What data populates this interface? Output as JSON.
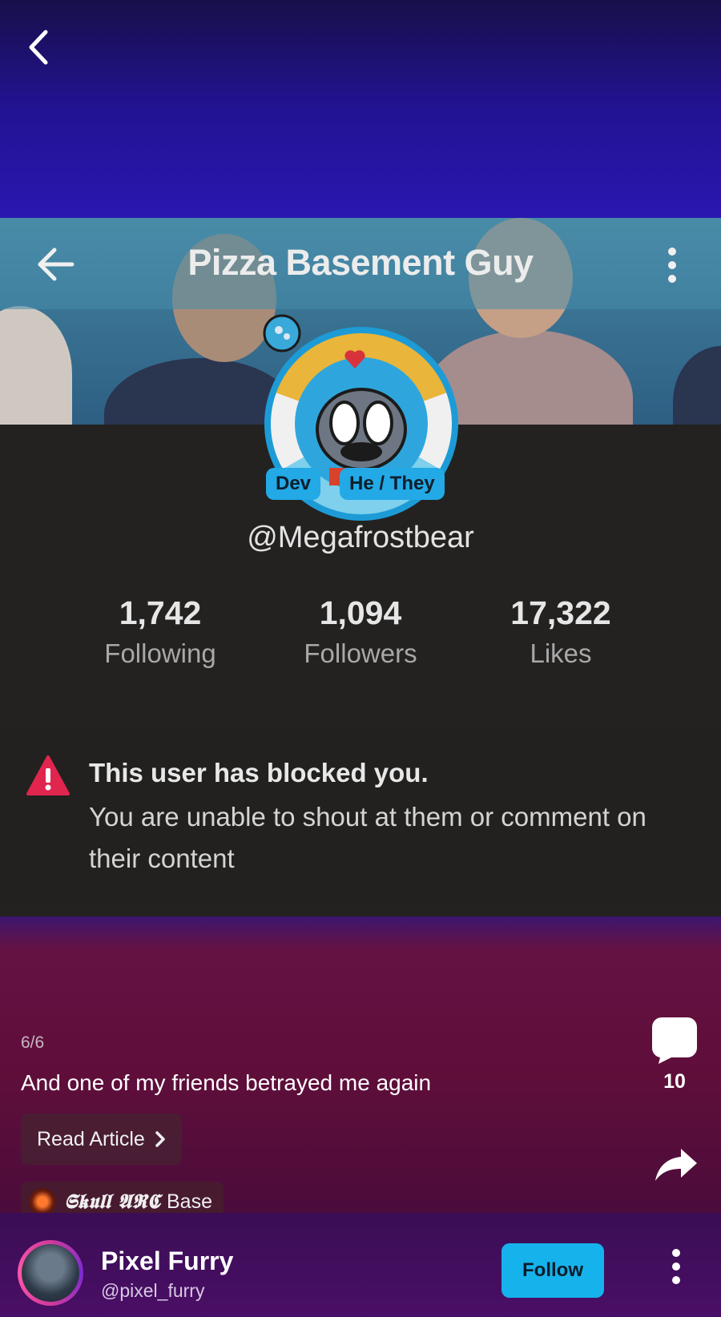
{
  "screen": {
    "post_counter": "6/6",
    "caption": "And one of my friends betrayed me again",
    "read_article_label": "Read Article",
    "community": {
      "prefix": "𝕾𝖐𝖚𝖑𝖑 𝕬𝕽𝕮",
      "name": "Base"
    },
    "comments_count": "10"
  },
  "embedded_profile": {
    "title": "Pizza Basement Guy",
    "tags": [
      "Dev",
      "He / They"
    ],
    "handle": "@Megafrostbear",
    "stats": [
      {
        "value": "1,742",
        "label": "Following"
      },
      {
        "value": "1,094",
        "label": "Followers"
      },
      {
        "value": "17,322",
        "label": "Likes"
      }
    ],
    "blocked_title": "This user has blocked you.",
    "blocked_message": "You are unable to shout at them or comment on their content"
  },
  "author": {
    "name": "Pixel Furry",
    "username": "@pixel_furry",
    "follow_label": "Follow"
  },
  "icons": {
    "back": "chevron-left-icon",
    "comment": "comment-bubble-icon",
    "share": "share-arrow-icon",
    "more": "more-vertical-icon",
    "warning": "warning-triangle-icon"
  },
  "colors": {
    "follow_button": "#16b2ec",
    "warning": "#e0254f"
  }
}
